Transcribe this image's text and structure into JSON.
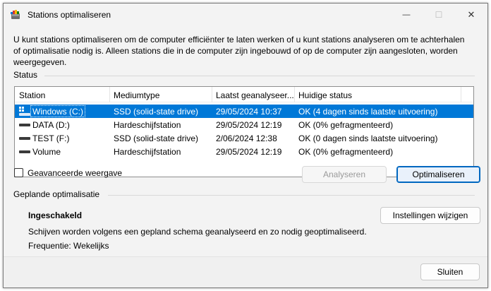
{
  "window": {
    "title": "Stations optimaliseren",
    "minimize_glyph": "—",
    "maximize_glyph": "☐",
    "close_glyph": "✕"
  },
  "intro": "U kunt stations optimaliseren om de computer efficiënter te laten werken of u kunt stations analyseren om te achterhalen of optimalisatie nodig is. Alleen stations die in de computer zijn ingebouwd of op de computer zijn aangesloten, worden weergegeven.",
  "status": {
    "label": "Status",
    "columns": [
      "Station",
      "Mediumtype",
      "Laatst geanalyseer...",
      "Huidige status"
    ],
    "rows": [
      {
        "station": "Windows  (C:)",
        "media": "SSD (solid-state drive)",
        "last": "29/05/2024 10:37",
        "status": "OK (4 dagen sinds laatste uitvoering)",
        "selected": true,
        "icon": "windows-drive-icon"
      },
      {
        "station": "DATA (D:)",
        "media": "Hardeschijfstation",
        "last": "29/05/2024 12:19",
        "status": "OK (0% gefragmenteerd)",
        "selected": false,
        "icon": "drive-icon"
      },
      {
        "station": "TEST (F:)",
        "media": "SSD (solid-state drive)",
        "last": "2/06/2024 12:38",
        "status": "OK (0 dagen sinds laatste uitvoering)",
        "selected": false,
        "icon": "drive-icon"
      },
      {
        "station": "Volume",
        "media": "Hardeschijfstation",
        "last": "29/05/2024 12:19",
        "status": "OK (0% gefragmenteerd)",
        "selected": false,
        "icon": "drive-icon"
      }
    ],
    "advanced_label": "Geavanceerde weergave",
    "analyze_label": "Analyseren",
    "optimize_label": "Optimaliseren"
  },
  "schedule": {
    "label": "Geplande optimalisatie",
    "state": "Ingeschakeld",
    "description": "Schijven worden volgens een gepland schema geanalyseerd en zo nodig geoptimaliseerd.",
    "frequency": "Frequentie: Wekelijks",
    "settings_label": "Instellingen wijzigen"
  },
  "footer": {
    "close_label": "Sluiten"
  },
  "colors": {
    "selection": "#0078d7",
    "primary_border": "#0067c0"
  }
}
